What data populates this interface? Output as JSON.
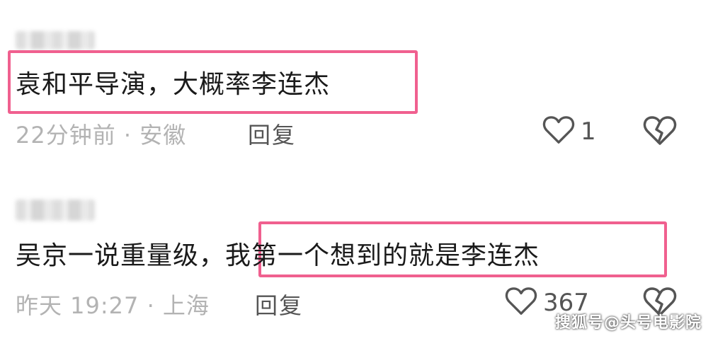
{
  "comments": [
    {
      "username": "",
      "content_prefix": "",
      "content_highlight": "袁和平导演，大概率李连杰",
      "time": "22分钟前",
      "location": "安徽",
      "reply_label": "回复",
      "like_count": "1"
    },
    {
      "username": "",
      "content_prefix": "吴京一说重量级，",
      "content_highlight": "我第一个想到的就是李连杰",
      "time": "昨天 19:27",
      "location": "上海",
      "reply_label": "回复",
      "like_count": "367"
    }
  ],
  "meta_separator": " · ",
  "watermark": "搜狐号@头号电影院",
  "icons": {
    "like": "heart-outline-icon",
    "dislike": "broken-heart-icon"
  },
  "colors": {
    "highlight_border": "#f0608f"
  }
}
